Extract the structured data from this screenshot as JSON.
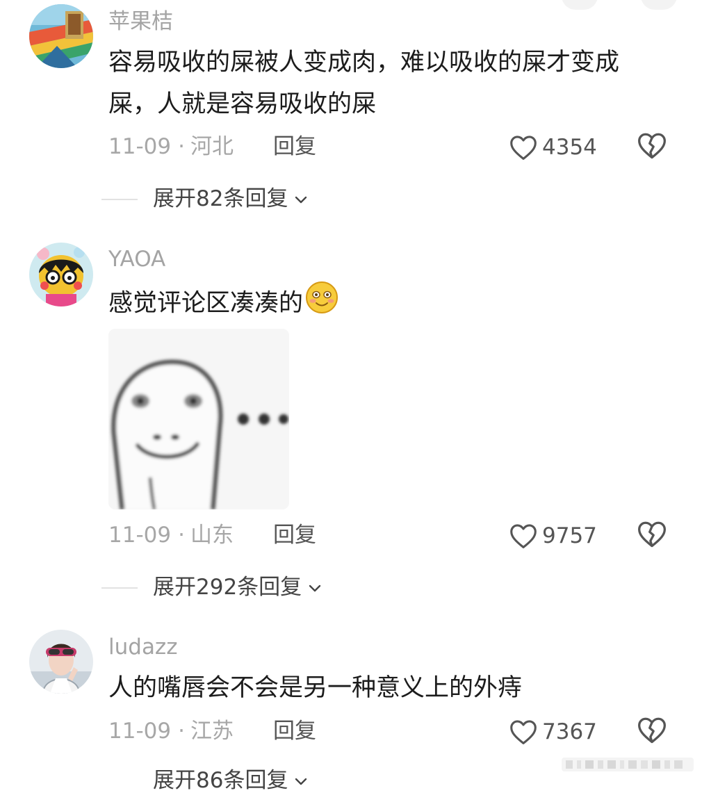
{
  "comments": [
    {
      "username": "苹果桔",
      "lines": [
        "容易吸收的屎被人变成肉，难以吸收的屎才变成",
        "屎，人就是容易吸收的屎"
      ],
      "date": "11-09",
      "location": "河北",
      "reply_label": "回复",
      "likes": "4354",
      "expand_label": "展开82条回复"
    },
    {
      "username": "YAOA",
      "lines": [
        "感觉评论区凑凑的"
      ],
      "date": "11-09",
      "location": "山东",
      "reply_label": "回复",
      "likes": "9757",
      "expand_label": "展开292条回复"
    },
    {
      "username": "ludazz",
      "lines": [
        "人的嘴唇会不会是另一种意义上的外痔"
      ],
      "date": "11-09",
      "location": "江苏",
      "reply_label": "回复",
      "likes": "7367",
      "expand_label": "展开86条回复"
    }
  ],
  "separator": "·",
  "icons": {
    "like": "heart-outline-icon",
    "dislike": "broken-heart-icon",
    "expand": "chevron-down-icon",
    "emoji": "blushing-smile-emoji"
  },
  "colors": {
    "username": "#a4a4a4",
    "text": "#1c1c1c",
    "meta": "#a7a7a7",
    "action": "#555555"
  }
}
